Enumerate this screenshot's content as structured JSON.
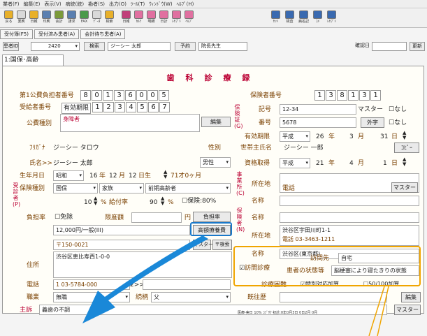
{
  "menu": {
    "items": [
      "業者(F)",
      "編集(E)",
      "表示(V)",
      "病統(統)",
      "勘者(S)",
      "出力(O)",
      "ﾂｰﾙ(T)",
      "ｳｨﾝﾄﾞｳ(W)",
      "ﾍﾙﾌﾟ(H)"
    ]
  },
  "toolbar": {
    "buttons": [
      "戻る",
      "業刷",
      "日報",
      "印刷",
      "会計",
      "請求",
      "FAX",
      "ﾃﾞｰﾀ",
      "検索",
      "日報",
      "ｶﾙﾃ",
      "明細",
      "日計",
      "ﾚｾﾌﾟﾄ",
      "ﾍﾙﾌﾟ"
    ],
    "right": [
      "ｾｯﾄ",
      "検査",
      "病名記",
      "ｺﾒ",
      "ﾚｾﾌﾟﾄ"
    ]
  },
  "tabs": [
    "受付簿(F5)",
    "受付済み患者(A)",
    "会計待ち患者(A)"
  ],
  "selbar": {
    "label": "患者ID",
    "id": "2420",
    "search": "検索",
    "name": "ジーシー 太郎",
    "reserve": "予約",
    "doctor": "院長先生",
    "confirm_label": "確認日",
    "update": "更新"
  },
  "subtab": "1:国保･高齢",
  "title": "歯科診療録",
  "insurer": {
    "label": "第1公費負担者番号",
    "digits": [
      "8",
      "0",
      "1",
      "3",
      "6",
      "0",
      "0",
      "5"
    ],
    "recipient_label": "受給者番号",
    "expiry_label": "有効期限",
    "recipient_digits": [
      "1",
      "2",
      "3",
      "4",
      "5",
      "6",
      "7"
    ],
    "kind_label": "公費種別",
    "kind_value": "身障者",
    "edit": "編集"
  },
  "insurance": {
    "no_label": "保険者番号",
    "no_digits": [
      "1",
      "3",
      "8",
      "1",
      "3",
      "1"
    ],
    "vlabel": "保険証(G)",
    "symbol_label": "記号",
    "symbol": "12-34",
    "master": "マスター",
    "none": "なし",
    "number_label": "番号",
    "number": "5678",
    "gaiji": "外字",
    "validity_label": "有効期限",
    "era": "平成",
    "year": "26",
    "year_u": "年",
    "month": "3",
    "month_u": "月",
    "day": "31",
    "day_u": "日"
  },
  "patient": {
    "vlabel": "受診者(P)",
    "kana_label": "ﾌﾘｶﾞﾅ",
    "kana": "ジーシー タロウ",
    "name_label": "氏名>>",
    "name": "ジーシー 太郎",
    "sex_label": "性別",
    "sex": "男性",
    "dob_label": "生年月日",
    "dob_era": "昭和",
    "dob_y": "16",
    "dob_yu": "年",
    "dob_m": "12",
    "dob_mu": "月",
    "dob_d": "12",
    "dob_du": "日生",
    "age": "71才0ヶ月",
    "type_label": "保険種別",
    "type": "国保",
    "family": "家族",
    "elderly": "前期高齢者",
    "head_label": "世帯主氏名",
    "head": "ジーシー 一郎",
    "copy": "ｺﾋﾟｰ",
    "acquire_label": "資格取得",
    "acq_era": "平成",
    "acq_y": "21",
    "acq_yu": "年",
    "acq_m": "4",
    "acq_mu": "月",
    "acq_d": "1",
    "acq_du": "日"
  },
  "workplace": {
    "vlabel": "事業所(C)",
    "addr_label": "所在地",
    "phone_label": "電話",
    "master": "マスター",
    "name_label": "名称"
  },
  "ratio": {
    "v1": "10",
    "pct": "%",
    "benefit_label": "給付率",
    "v2": "90",
    "pct2": "%",
    "ins_rate": "保険:80%",
    "burden_label": "負担率",
    "exempt": "免除",
    "limit_label": "限度額",
    "yen": "円",
    "burden_btn": "負担率",
    "limit_text": "12,000円/一般(III)",
    "high_cost": "高額療養費"
  },
  "insurer_box": {
    "vlabel": "保険者(N)",
    "name_label": "名称",
    "addr_label": "所在地",
    "addr": "渋谷区宇田川町1-1",
    "phone": "電話 03-3463-1211",
    "name": "渋谷区(東京都)"
  },
  "address": {
    "zip": "〒150-0021",
    "master": "マスター",
    "zip_search": "〒検索",
    "label": "住所",
    "value": "渋谷区恵比寿西1-0-0",
    "phone_label": "電話",
    "phone": "1 03-5784-000",
    "phone_more": "2>>",
    "job_label": "職業",
    "job": "無職",
    "relation_label": "続柄",
    "relation": "父",
    "history_label": "既往歴",
    "edit": "編集"
  },
  "visit": {
    "label": "訪問診療",
    "dest_label": "訪問先",
    "dest": "自宅",
    "state_label": "患者の状態等",
    "state": "脳梗塞により寝たきりの状態",
    "difficulty_label": "診療困難",
    "special": "特別対応加算",
    "rate": "50/100加算"
  },
  "complaint": {
    "label": "主訴",
    "value": "義歯の不調",
    "master": "マスター"
  },
  "status": "医療-実日 10% ｺﾌﾞｻｸ 初診:0年0月3日 0日2月 0月"
}
